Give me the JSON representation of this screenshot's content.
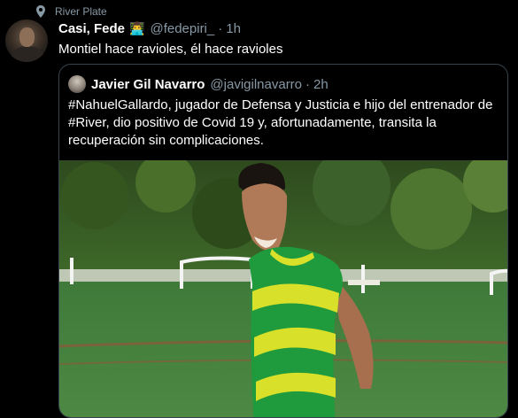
{
  "context": {
    "icon": "location-pin-icon",
    "label": "River Plate"
  },
  "tweet": {
    "author_name": "Casi, Fede",
    "badge_emoji": "👨‍💻",
    "handle": "@fedepiri_",
    "separator": "·",
    "time": "1h",
    "text": "Montiel hace ravioles, él hace ravioles"
  },
  "quoted_tweet": {
    "author_name": "Javier Gil Navarro",
    "handle": "@javigilnavarro",
    "separator": "·",
    "time": "2h",
    "text": "#NahuelGallardo, jugador de Defensa y Justicia e hijo del entrenador de #River, dio positivo de Covid 19 y, afortunadamente, transita la recuperación sin complicaciones."
  },
  "colors": {
    "background": "#000000",
    "secondary_text": "#8899a6",
    "border": "#38444d",
    "jersey_green": "#1f9a3c",
    "jersey_yellow": "#d8e02a"
  }
}
